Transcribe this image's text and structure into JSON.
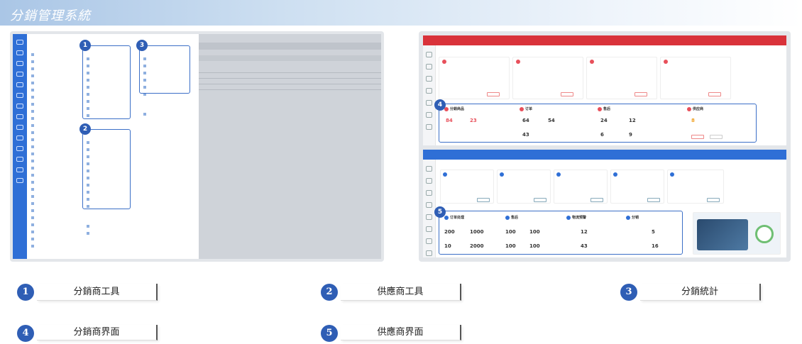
{
  "header": {
    "title": "分銷管理系統"
  },
  "legend": [
    {
      "num": "1",
      "label": "分銷商工具"
    },
    {
      "num": "2",
      "label": "供應商工具"
    },
    {
      "num": "3",
      "label": "分銷統計"
    },
    {
      "num": "4",
      "label": "分銷商界面"
    },
    {
      "num": "5",
      "label": "供應商界面"
    }
  ],
  "screens": {
    "distributor_dashboard": {
      "cards_top": [
        {
          "title": "分銷商品",
          "v1": "84",
          "v2": "23"
        },
        {
          "title": "订单",
          "v1": "64",
          "v2": "54"
        },
        {
          "title": "售后",
          "v1": "24",
          "v2": "12"
        },
        {
          "title": "供应商",
          "v1": "8"
        }
      ],
      "extra": {
        "v1": "43",
        "v2": "6",
        "v3": "9"
      }
    },
    "supplier_dashboard": {
      "cards": [
        {
          "title": "订单处理",
          "v1": "200",
          "v2": "1000",
          "v3": "10",
          "v4": "2000"
        },
        {
          "title": "售后",
          "v1": "100",
          "v2": "100",
          "v3": "100",
          "v4": "100"
        },
        {
          "title": "物流预警",
          "v1": "12",
          "v2": "43"
        },
        {
          "title": "分销",
          "v1": "5",
          "v2": "16"
        }
      ]
    }
  },
  "colors": {
    "accent": "#2f5eb5",
    "red_header": "#d9323a",
    "blue_header": "#2f6fd6"
  }
}
